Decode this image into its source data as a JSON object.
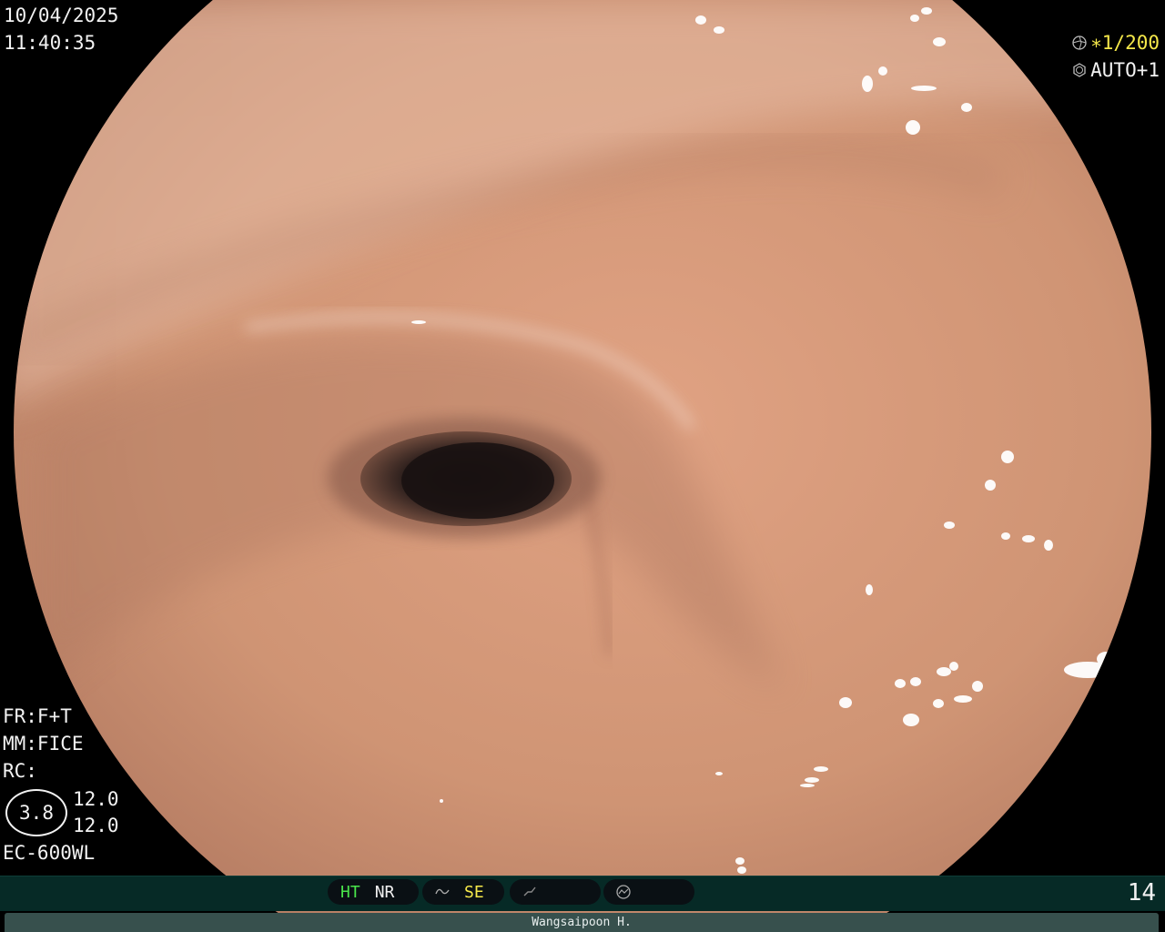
{
  "overlay": {
    "date": "10/04/2025",
    "time": "11:40:35",
    "shutter": "∗1/200",
    "exposure": "AUTO+1",
    "fr": "FR:F+T",
    "mm": "MM:FICE",
    "rc": "RC:",
    "zoom_circle": "3.8",
    "zoom_top": "12.0",
    "zoom_bottom": "12.0",
    "scope_model": "EC-600WL"
  },
  "status_bar": {
    "ht": "HT",
    "nr": "NR",
    "se": "SE",
    "image_number": "14"
  },
  "footer": {
    "operator": "Wangsaipoon H."
  },
  "colors": {
    "accent_yellow": "#f5e84a",
    "accent_green": "#49e34a",
    "bar_bg": "#062a26"
  },
  "icons": [
    "shutter-icon",
    "iris-icon",
    "structure-enhance-icon",
    "color-enhance-icon",
    "mode-icon"
  ]
}
